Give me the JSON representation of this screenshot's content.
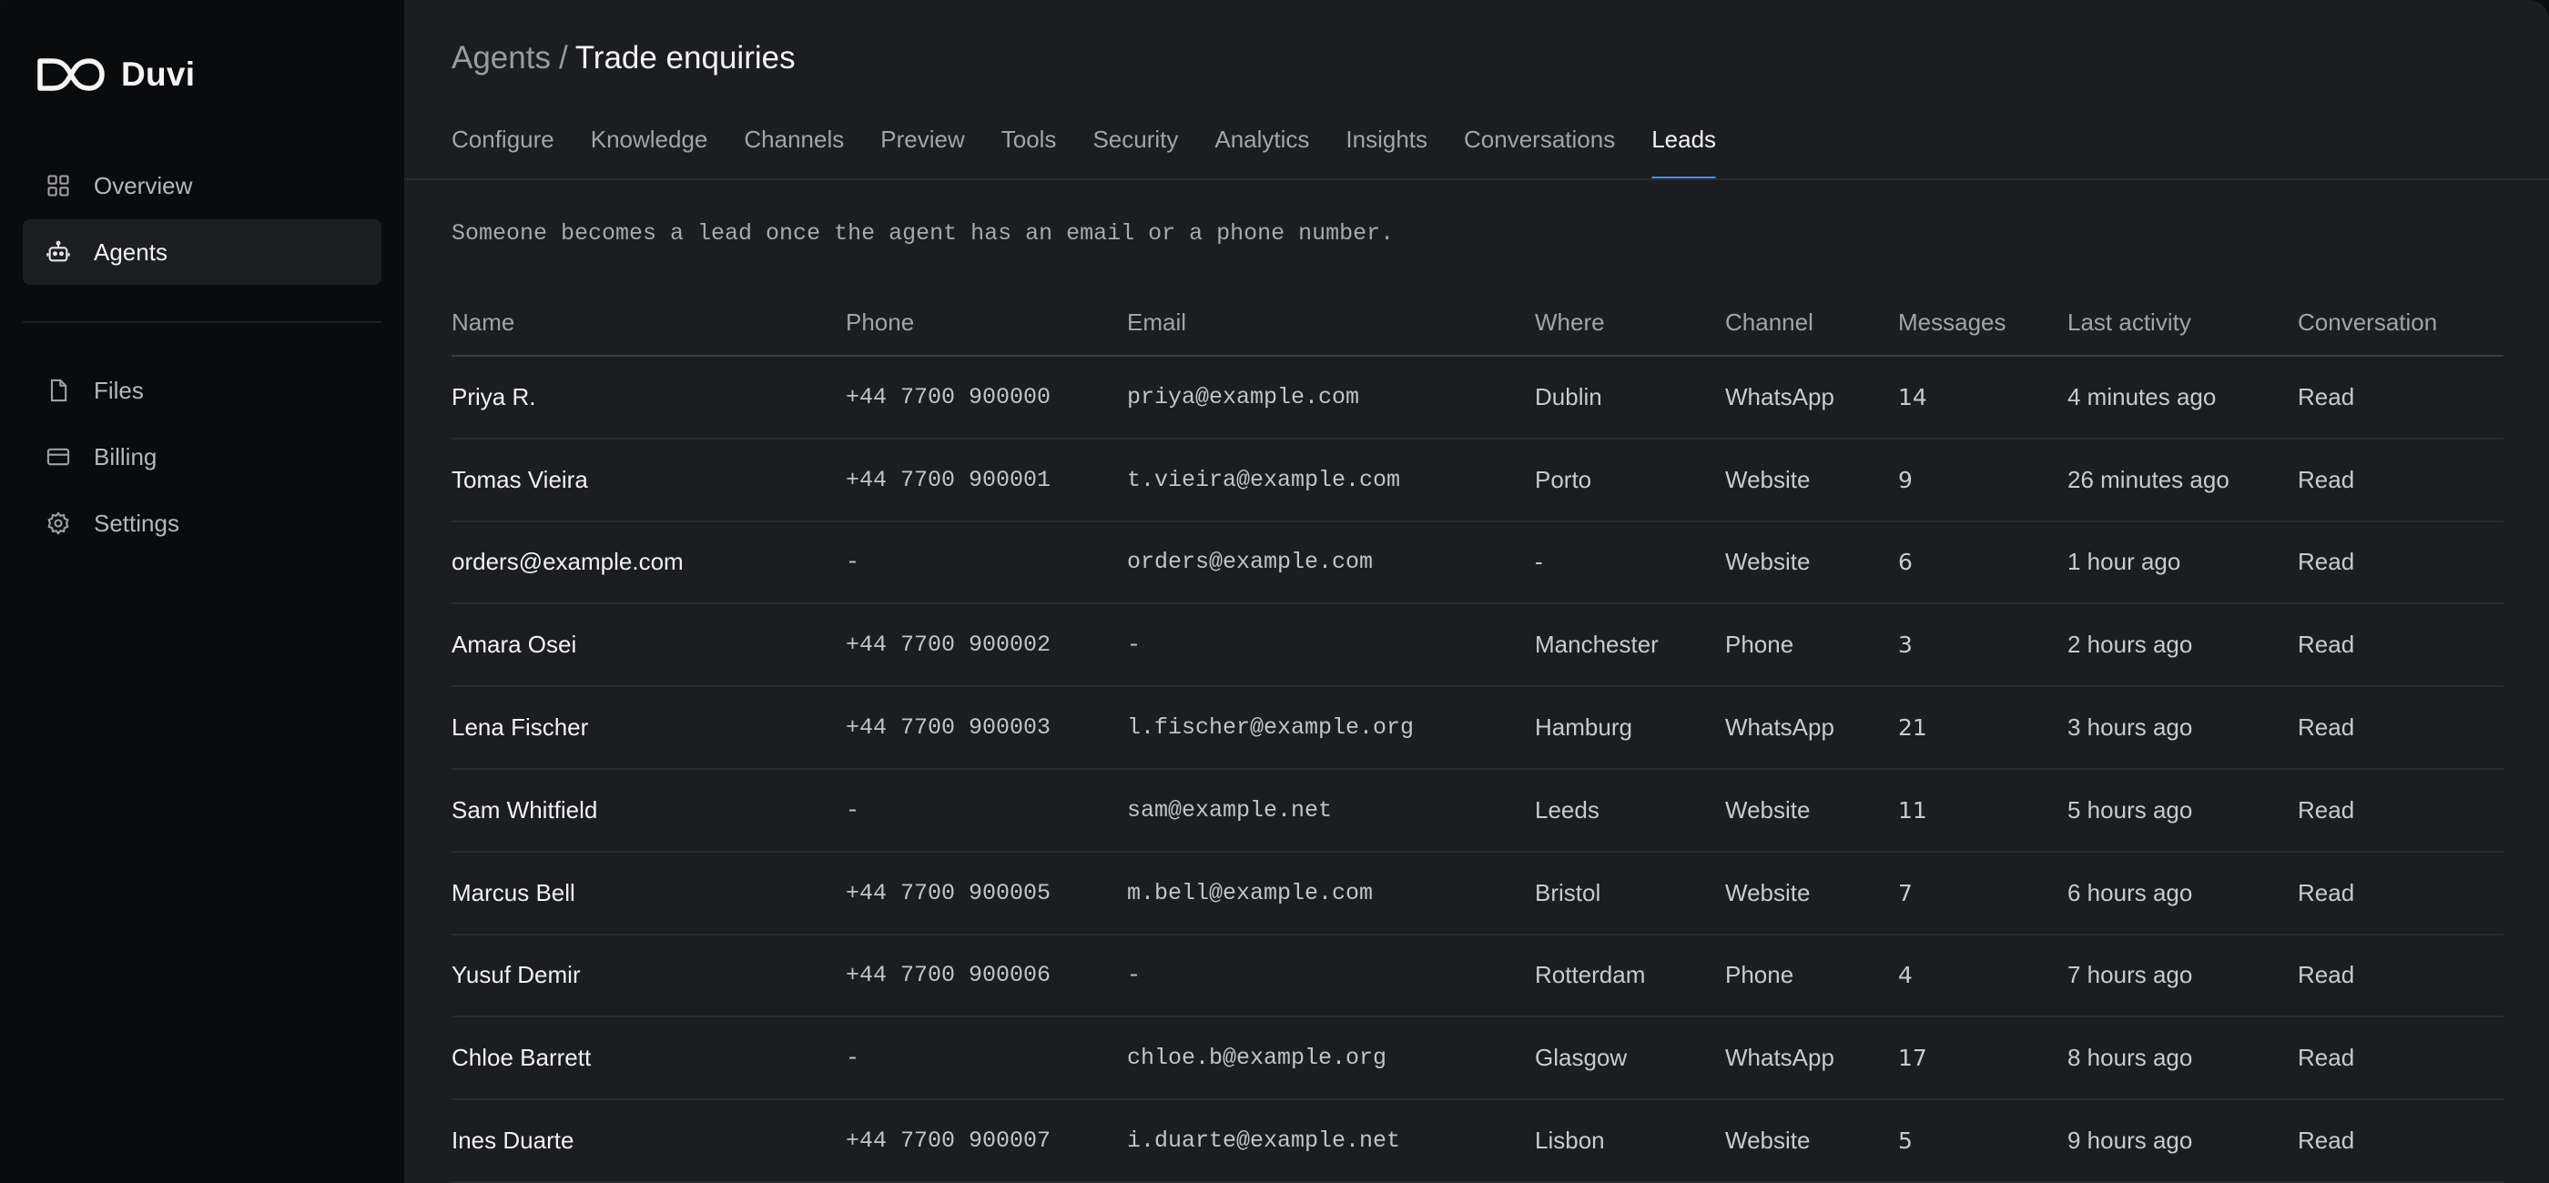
{
  "brand": {
    "name": "Duvi"
  },
  "sidebar": {
    "primary": [
      {
        "label": "Overview",
        "icon": "grid-icon",
        "active": false
      },
      {
        "label": "Agents",
        "icon": "robot-icon",
        "active": true
      }
    ],
    "secondary": [
      {
        "label": "Files",
        "icon": "file-icon"
      },
      {
        "label": "Billing",
        "icon": "card-icon"
      },
      {
        "label": "Settings",
        "icon": "gear-icon"
      }
    ]
  },
  "header": {
    "parent": "Agents",
    "separator": "/",
    "current": "Trade enquiries"
  },
  "tabs": [
    {
      "label": "Configure"
    },
    {
      "label": "Knowledge"
    },
    {
      "label": "Channels"
    },
    {
      "label": "Preview"
    },
    {
      "label": "Tools"
    },
    {
      "label": "Security"
    },
    {
      "label": "Analytics"
    },
    {
      "label": "Insights"
    },
    {
      "label": "Conversations"
    },
    {
      "label": "Leads"
    }
  ],
  "active_tab": "Leads",
  "leads": {
    "note": "Someone becomes a lead once the agent has an email or a phone number.",
    "columns": [
      "Name",
      "Phone",
      "Email",
      "Where",
      "Channel",
      "Messages",
      "Last activity",
      "Conversation"
    ],
    "rows": [
      {
        "name": "Priya R.",
        "phone": "+44 7700 900000",
        "email": "priya@example.com",
        "where": "Dublin",
        "channel": "WhatsApp",
        "messages": "14",
        "last": "4 minutes ago",
        "action": "Read"
      },
      {
        "name": "Tomas Vieira",
        "phone": "+44 7700 900001",
        "email": "t.vieira@example.com",
        "where": "Porto",
        "channel": "Website",
        "messages": "9",
        "last": "26 minutes ago",
        "action": "Read"
      },
      {
        "name": "orders@example.com",
        "phone": "-",
        "email": "orders@example.com",
        "where": "-",
        "channel": "Website",
        "messages": "6",
        "last": "1 hour ago",
        "action": "Read"
      },
      {
        "name": "Amara Osei",
        "phone": "+44 7700 900002",
        "email": "-",
        "where": "Manchester",
        "channel": "Phone",
        "messages": "3",
        "last": "2 hours ago",
        "action": "Read"
      },
      {
        "name": "Lena Fischer",
        "phone": "+44 7700 900003",
        "email": "l.fischer@example.org",
        "where": "Hamburg",
        "channel": "WhatsApp",
        "messages": "21",
        "last": "3 hours ago",
        "action": "Read"
      },
      {
        "name": "Sam Whitfield",
        "phone": "-",
        "email": "sam@example.net",
        "where": "Leeds",
        "channel": "Website",
        "messages": "11",
        "last": "5 hours ago",
        "action": "Read"
      },
      {
        "name": "Marcus Bell",
        "phone": "+44 7700 900005",
        "email": "m.bell@example.com",
        "where": "Bristol",
        "channel": "Website",
        "messages": "7",
        "last": "6 hours ago",
        "action": "Read"
      },
      {
        "name": "Yusuf Demir",
        "phone": "+44 7700 900006",
        "email": "-",
        "where": "Rotterdam",
        "channel": "Phone",
        "messages": "4",
        "last": "7 hours ago",
        "action": "Read"
      },
      {
        "name": "Chloe Barrett",
        "phone": "-",
        "email": "chloe.b@example.org",
        "where": "Glasgow",
        "channel": "WhatsApp",
        "messages": "17",
        "last": "8 hours ago",
        "action": "Read"
      },
      {
        "name": "Ines Duarte",
        "phone": "+44 7700 900007",
        "email": "i.duarte@example.net",
        "where": "Lisbon",
        "channel": "Website",
        "messages": "5",
        "last": "9 hours ago",
        "action": "Read"
      }
    ]
  },
  "colors": {
    "accent": "#4f8fdc",
    "sidebar_bg": "#0a0b0d",
    "main_bg": "#1c1d20",
    "active_nav_bg": "#1d1e21"
  }
}
